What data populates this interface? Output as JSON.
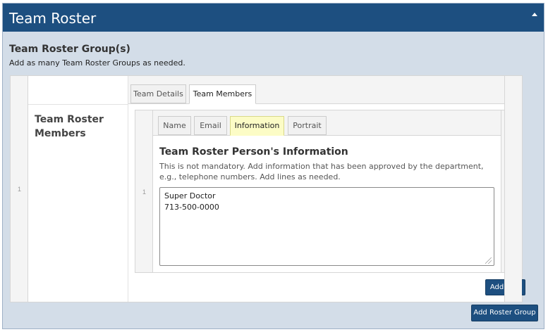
{
  "panel": {
    "title": "Team Roster"
  },
  "group": {
    "heading": "Team Roster Group(s)",
    "description": "Add as many Team Roster Groups as needed."
  },
  "outer_row": {
    "number": "1",
    "field_label": "Team Roster Members",
    "tabs": [
      {
        "label": "Team Details",
        "active": false
      },
      {
        "label": "Team Members",
        "active": true
      }
    ]
  },
  "inner_row": {
    "number": "1",
    "tabs": [
      {
        "label": "Name",
        "active": false
      },
      {
        "label": "Email",
        "active": false
      },
      {
        "label": "Information",
        "active": true
      },
      {
        "label": "Portrait",
        "active": false
      }
    ],
    "info_title": "Team Roster Person's Information",
    "info_description": "This is not mandatory. Add information that has been approved by the department, e.g., telephone numbers. Add lines as needed.",
    "textarea_value": "Super Doctor\n713-500-0000"
  },
  "buttons": {
    "add_row": "Add Row",
    "add_roster_group": "Add Roster Group"
  },
  "colors": {
    "header_bg": "#1d4f80",
    "panel_bg": "#d3dde8",
    "active_tab_highlight": "#fcfcc6"
  }
}
